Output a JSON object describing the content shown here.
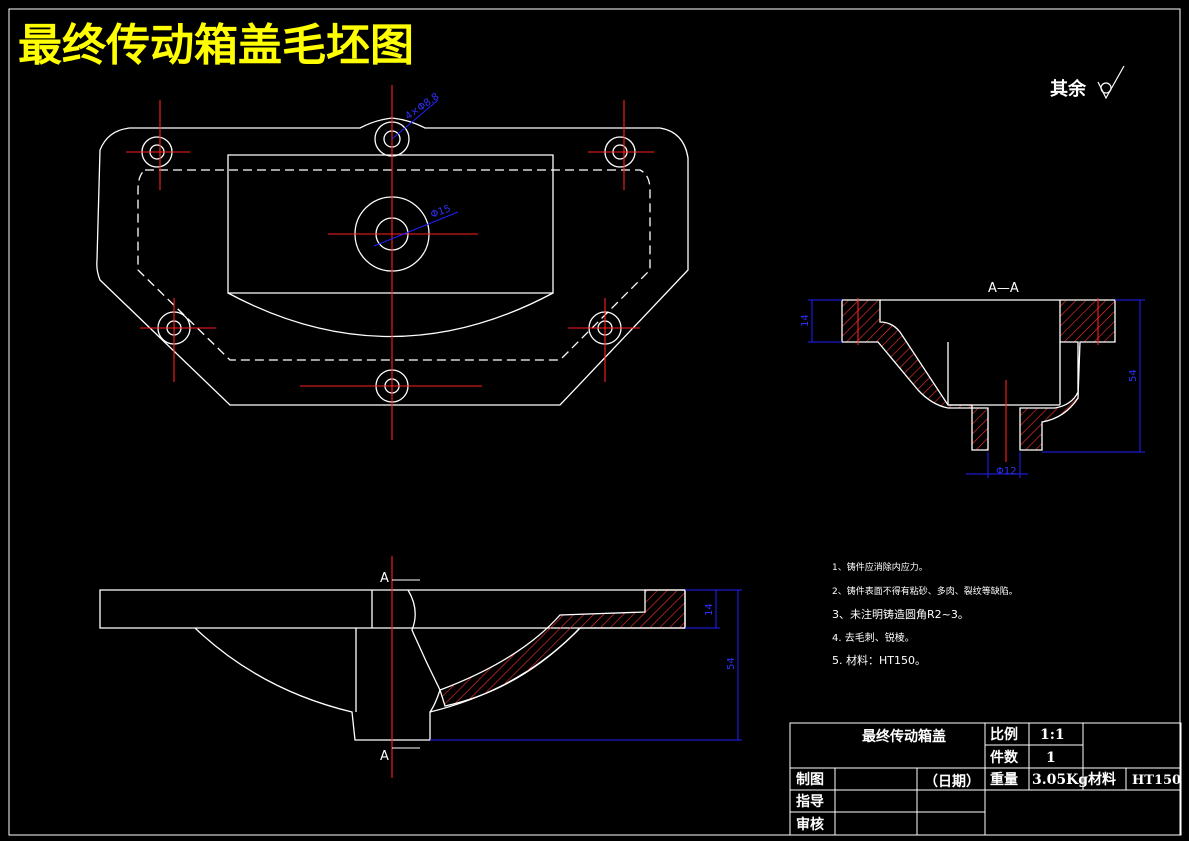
{
  "title": "最终传动箱盖毛坯图",
  "surface_note": "其余",
  "section_label": "A—A",
  "cut_marks": [
    "A",
    "A"
  ],
  "dims": {
    "d_hole_small": "4×Φ8.8",
    "d_hole_center": "Φ15",
    "d_bore": "Φ12",
    "h_flange_1": "14",
    "h_total_1": "54",
    "h_flange_2": "14",
    "h_total_2": "54"
  },
  "notes": [
    "1、铸件应消除内应力。",
    "2、铸件表面不得有粘砂、多肉、裂纹等缺陷。",
    "3、未注明铸造圆角R2~3。",
    "4. 去毛刺、锐棱。",
    "5. 材料：HT150。"
  ],
  "title_block": {
    "part_name": "最终传动箱盖",
    "scale_label": "比例",
    "scale_value": "1:1",
    "qty_label": "件数",
    "qty_value": "1",
    "drawn_label": "制图",
    "date_label": "（日期）",
    "weight_label": "重量",
    "weight_value": "3.05Kg",
    "material_label": "材料",
    "material_value": "HT150",
    "guide_label": "指导",
    "review_label": "审核"
  },
  "colors": {
    "background": "#000000",
    "outline": "#ffffff",
    "centerline": "#ff0000",
    "dimension": "#0000ff",
    "title": "#ffff00",
    "hatch": "#ff0000"
  }
}
